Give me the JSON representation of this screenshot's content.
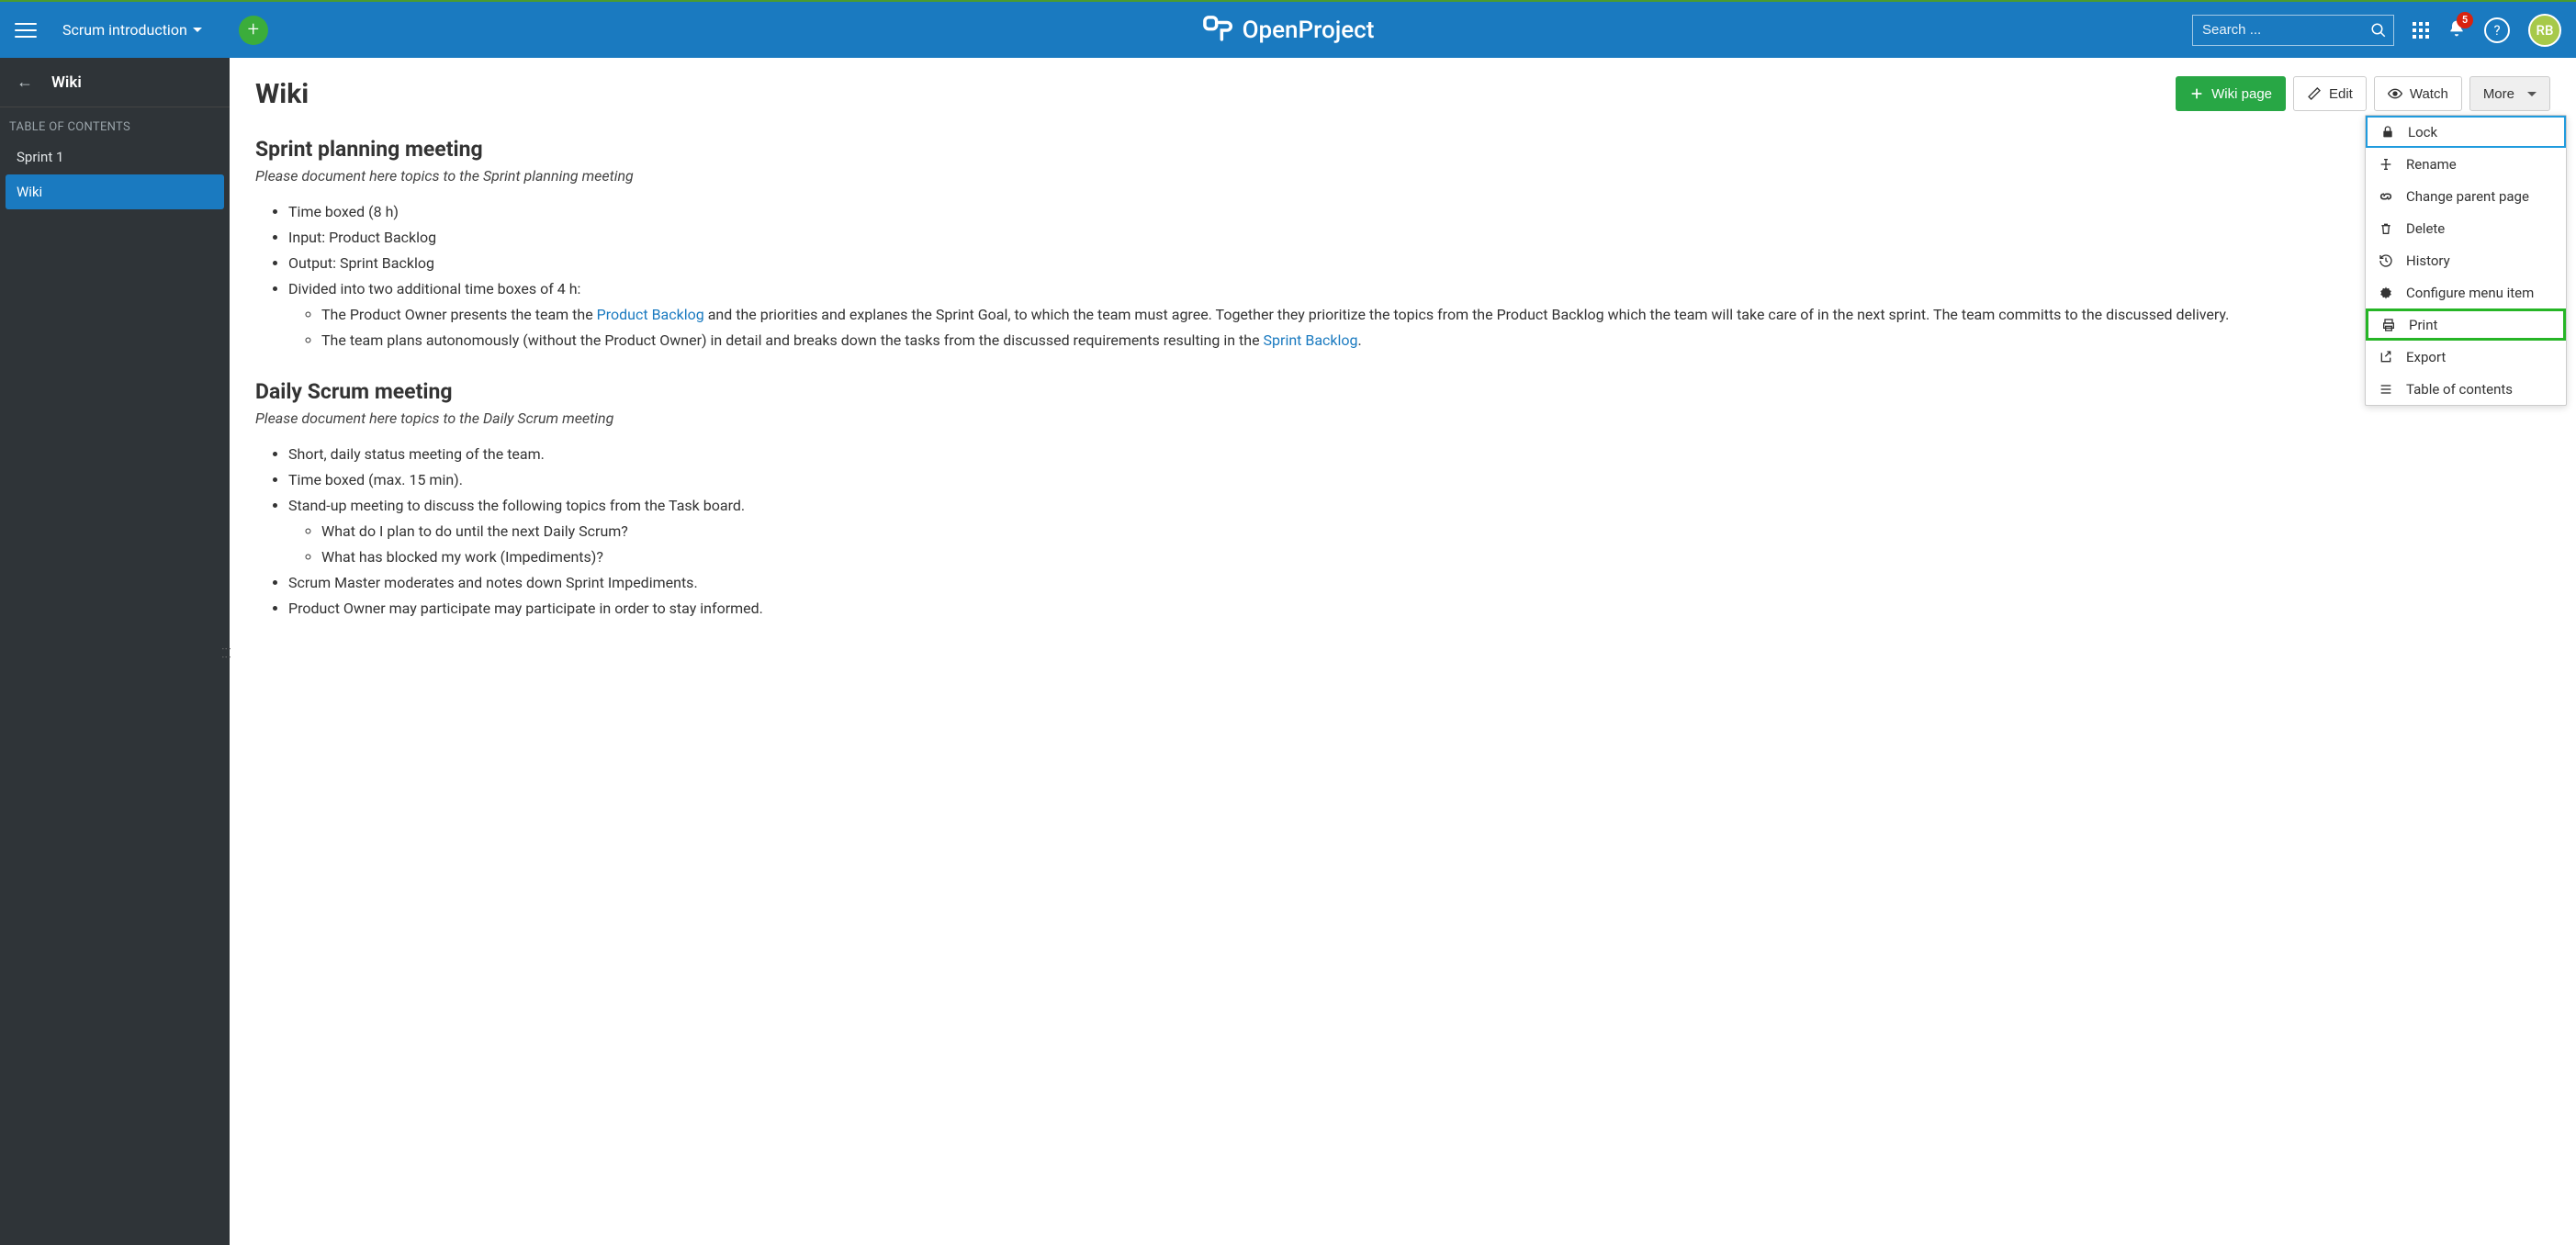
{
  "header": {
    "project_name": "Scrum introduction",
    "brand": "OpenProject",
    "search_placeholder": "Search ...",
    "notification_count": "5",
    "avatar_initials": "RB"
  },
  "sidebar": {
    "title": "Wiki",
    "toc_label": "TABLE OF CONTENTS",
    "items": [
      {
        "label": "Sprint 1",
        "active": false
      },
      {
        "label": "Wiki",
        "active": true
      }
    ]
  },
  "page": {
    "title": "Wiki",
    "actions": {
      "wiki_page": "Wiki page",
      "edit": "Edit",
      "watch": "Watch",
      "more": "More"
    }
  },
  "dropdown": {
    "lock": "Lock",
    "rename": "Rename",
    "change_parent": "Change parent page",
    "delete": "Delete",
    "history": "History",
    "configure": "Configure menu item",
    "print": "Print",
    "export": "Export",
    "toc": "Table of contents"
  },
  "content": {
    "section1": {
      "heading": "Sprint planning meeting",
      "subtitle": "Please document here topics to the Sprint planning meeting",
      "li1": "Time boxed (8 h)",
      "li2": "Input: Product Backlog",
      "li3": "Output: Sprint Backlog",
      "li4": "Divided into two additional time boxes of 4 h:",
      "sub1_a": "The Product Owner presents the team the ",
      "sub1_link": "Product Backlog",
      "sub1_b": " and the priorities and explanes the Sprint Goal, to which the team must agree. Together they prioritize the topics from the Product Backlog which the team will take care of in the next sprint. The team committs to the discussed delivery.",
      "sub2_a": "The team plans autonomously (without the Product Owner) in detail and breaks down the tasks from the discussed requirements resulting in the ",
      "sub2_link": "Sprint Backlog",
      "sub2_b": "."
    },
    "section2": {
      "heading": "Daily Scrum meeting",
      "subtitle": "Please document here topics to the Daily Scrum meeting",
      "li1": "Short, daily status meeting of the team.",
      "li2": "Time boxed (max. 15 min).",
      "li3": "Stand-up meeting to discuss the following topics from the Task board.",
      "sub1": "What do I plan to do until the next Daily Scrum?",
      "sub2": "What has blocked my work (Impediments)?",
      "li4": "Scrum Master moderates and notes down Sprint Impediments.",
      "li5": "Product Owner may participate may participate in order to stay informed."
    }
  }
}
